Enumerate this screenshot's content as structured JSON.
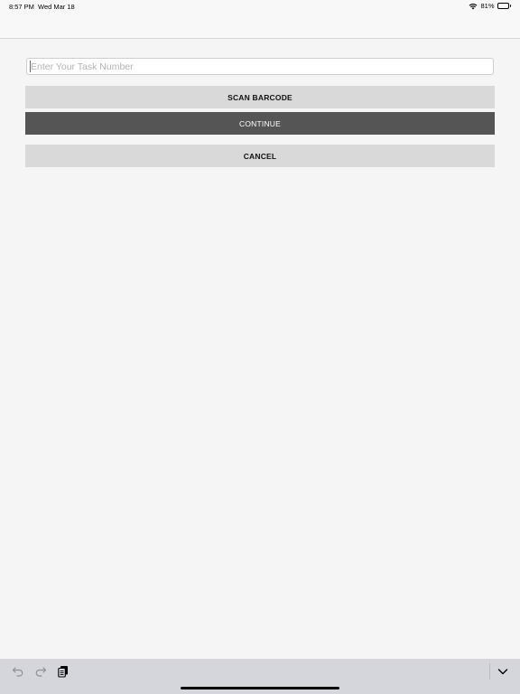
{
  "status_bar": {
    "time": "8:57 PM",
    "date": "Wed Mar 18",
    "battery": "81%",
    "battery_level": 0.81
  },
  "form": {
    "task_input": {
      "value": "",
      "placeholder": "Enter Your Task Number"
    },
    "scan_label": "SCAN BARCODE",
    "continue_label": "CONTINUE",
    "cancel_label": "CANCEL"
  },
  "keyboard_toolbar": {
    "icons": [
      "undo-icon",
      "redo-icon",
      "paste-icon",
      "dismiss-keyboard-icon"
    ]
  },
  "colors": {
    "background": "#f5f5f5",
    "button_light": "#d9d9d9",
    "button_dark": "#555555",
    "toolbar": "#d4d6db"
  }
}
